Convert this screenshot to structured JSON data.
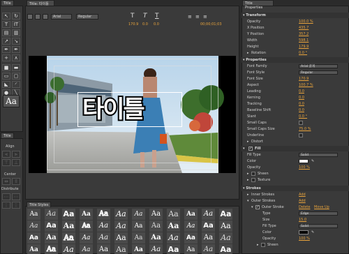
{
  "left_tools": {
    "tab_label": "Title",
    "preview_label": "Aa",
    "align_tab": "Title",
    "align_label": "Align",
    "center_label": "Center",
    "distribute_label": "Distribute"
  },
  "canvas": {
    "tab_label": "Title: 타이틀",
    "font_family": "Arial",
    "font_style": "Regular",
    "coords": [
      "170.9",
      "0.0",
      "0.0"
    ],
    "timecode": "00;00;01;03",
    "title_text": "타이틀"
  },
  "styles": {
    "tab_label": "Title Styles",
    "cells": [
      "Aa",
      "Aa",
      "Aa",
      "Aa",
      "Aa",
      "Aa",
      "Aa",
      "Aa",
      "Aa",
      "Aa",
      "Aa",
      "Aa",
      "Aa",
      "Aa",
      "Aa",
      "Aa",
      "Aa",
      "Aa",
      "Aa",
      "Aa",
      "Aa",
      "Aa",
      "Aa",
      "Aa",
      "Aa",
      "Aa",
      "Aa",
      "Aa",
      "Aa",
      "Aa",
      "Aa",
      "Aa",
      "Aa",
      "Aa",
      "Aa",
      "Aa",
      "Aa",
      "Aa",
      "Aa",
      "Aa",
      "Aa",
      "Aa",
      "Aa",
      "Aa",
      "Aa",
      "Aa",
      "Aa",
      "Aa"
    ]
  },
  "properties": {
    "tab_label": "Title Properties",
    "transform": {
      "header": "Transform",
      "rows": [
        {
          "label": "Opacity",
          "value": "100.0 %"
        },
        {
          "label": "X Position",
          "value": "435.7"
        },
        {
          "label": "Y Position",
          "value": "357.2"
        },
        {
          "label": "Width",
          "value": "598.1"
        },
        {
          "label": "Height",
          "value": "179.9"
        },
        {
          "label": "Rotation",
          "value": "0.0 °"
        }
      ]
    },
    "props": {
      "header": "Properties",
      "font_family_label": "Font Family",
      "font_family_value": "Arial 굵게",
      "font_style_label": "Font Style",
      "font_style_value": "Regular",
      "rows": [
        {
          "label": "Font Size",
          "value": "170.9"
        },
        {
          "label": "Aspect",
          "value": "100.7 %"
        },
        {
          "label": "Leading",
          "value": "0.0"
        },
        {
          "label": "Kerning",
          "value": "0.0"
        },
        {
          "label": "Tracking",
          "value": "0.0"
        },
        {
          "label": "Baseline Shift",
          "value": "0.0"
        },
        {
          "label": "Slant",
          "value": "0.0 °"
        }
      ],
      "small_caps": "Small Caps",
      "small_caps_size_label": "Small Caps Size",
      "small_caps_size_value": "75.0 %",
      "underline": "Underline",
      "distort": "Distort"
    },
    "fill": {
      "label": "Fill",
      "fill_type_label": "Fill Type",
      "fill_type_value": "Solid",
      "color_label": "Color",
      "opacity_label": "Opacity",
      "opacity_value": "100 %",
      "sheen": "Sheen",
      "texture": "Texture"
    },
    "strokes": {
      "header": "Strokes",
      "inner": "Inner Strokes",
      "outer": "Outer Strokes",
      "add": "Add",
      "outer_stroke": "Outer Stroke",
      "delete": "Delete",
      "move_up": "Move Up",
      "type_label": "Type",
      "type_value": "Edge",
      "size_label": "Size",
      "size_value": "15.0",
      "fill_type_label": "Fill Type",
      "fill_type_value": "Solid",
      "color_label": "Color",
      "opacity_label": "Opacity",
      "opacity_value": "100 %",
      "sheen": "Sheen"
    }
  },
  "colors": {
    "accent": "#e8a33c",
    "panel_bg": "#3a3a3a",
    "stroke_black": "#000000",
    "fill_color": "#ffffff"
  }
}
